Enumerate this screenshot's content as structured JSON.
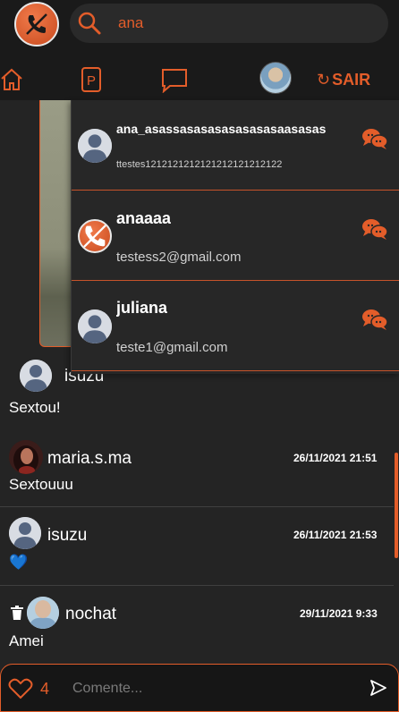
{
  "search": {
    "query": "ana"
  },
  "nav": {
    "logout_label": "SAIR",
    "logout_icon": "↻"
  },
  "comments": [
    {
      "name": "isuzu",
      "date": "",
      "text": "Sextou!"
    },
    {
      "name": "maria.s.ma",
      "date": "26/11/2021 21:51",
      "text": "Sextouuu"
    },
    {
      "name": "isuzu",
      "date": "26/11/2021 21:53",
      "text": "💙"
    },
    {
      "name": "nochat",
      "date": "29/11/2021 9:33",
      "text": "Amei"
    }
  ],
  "footer": {
    "like_count": "4",
    "comment_placeholder": "Comente..."
  },
  "results": [
    {
      "name": "ana_asassasasasasasasasaasasas",
      "sub": "ttestes1212121212121212121212122"
    },
    {
      "name": "anaaaa",
      "sub": "testess2@gmail.com"
    },
    {
      "name": "juliana",
      "sub": "teste1@gmail.com"
    }
  ],
  "colors": {
    "accent": "#e35d2a",
    "background": "#242424",
    "bar": "#1a1a1a"
  }
}
